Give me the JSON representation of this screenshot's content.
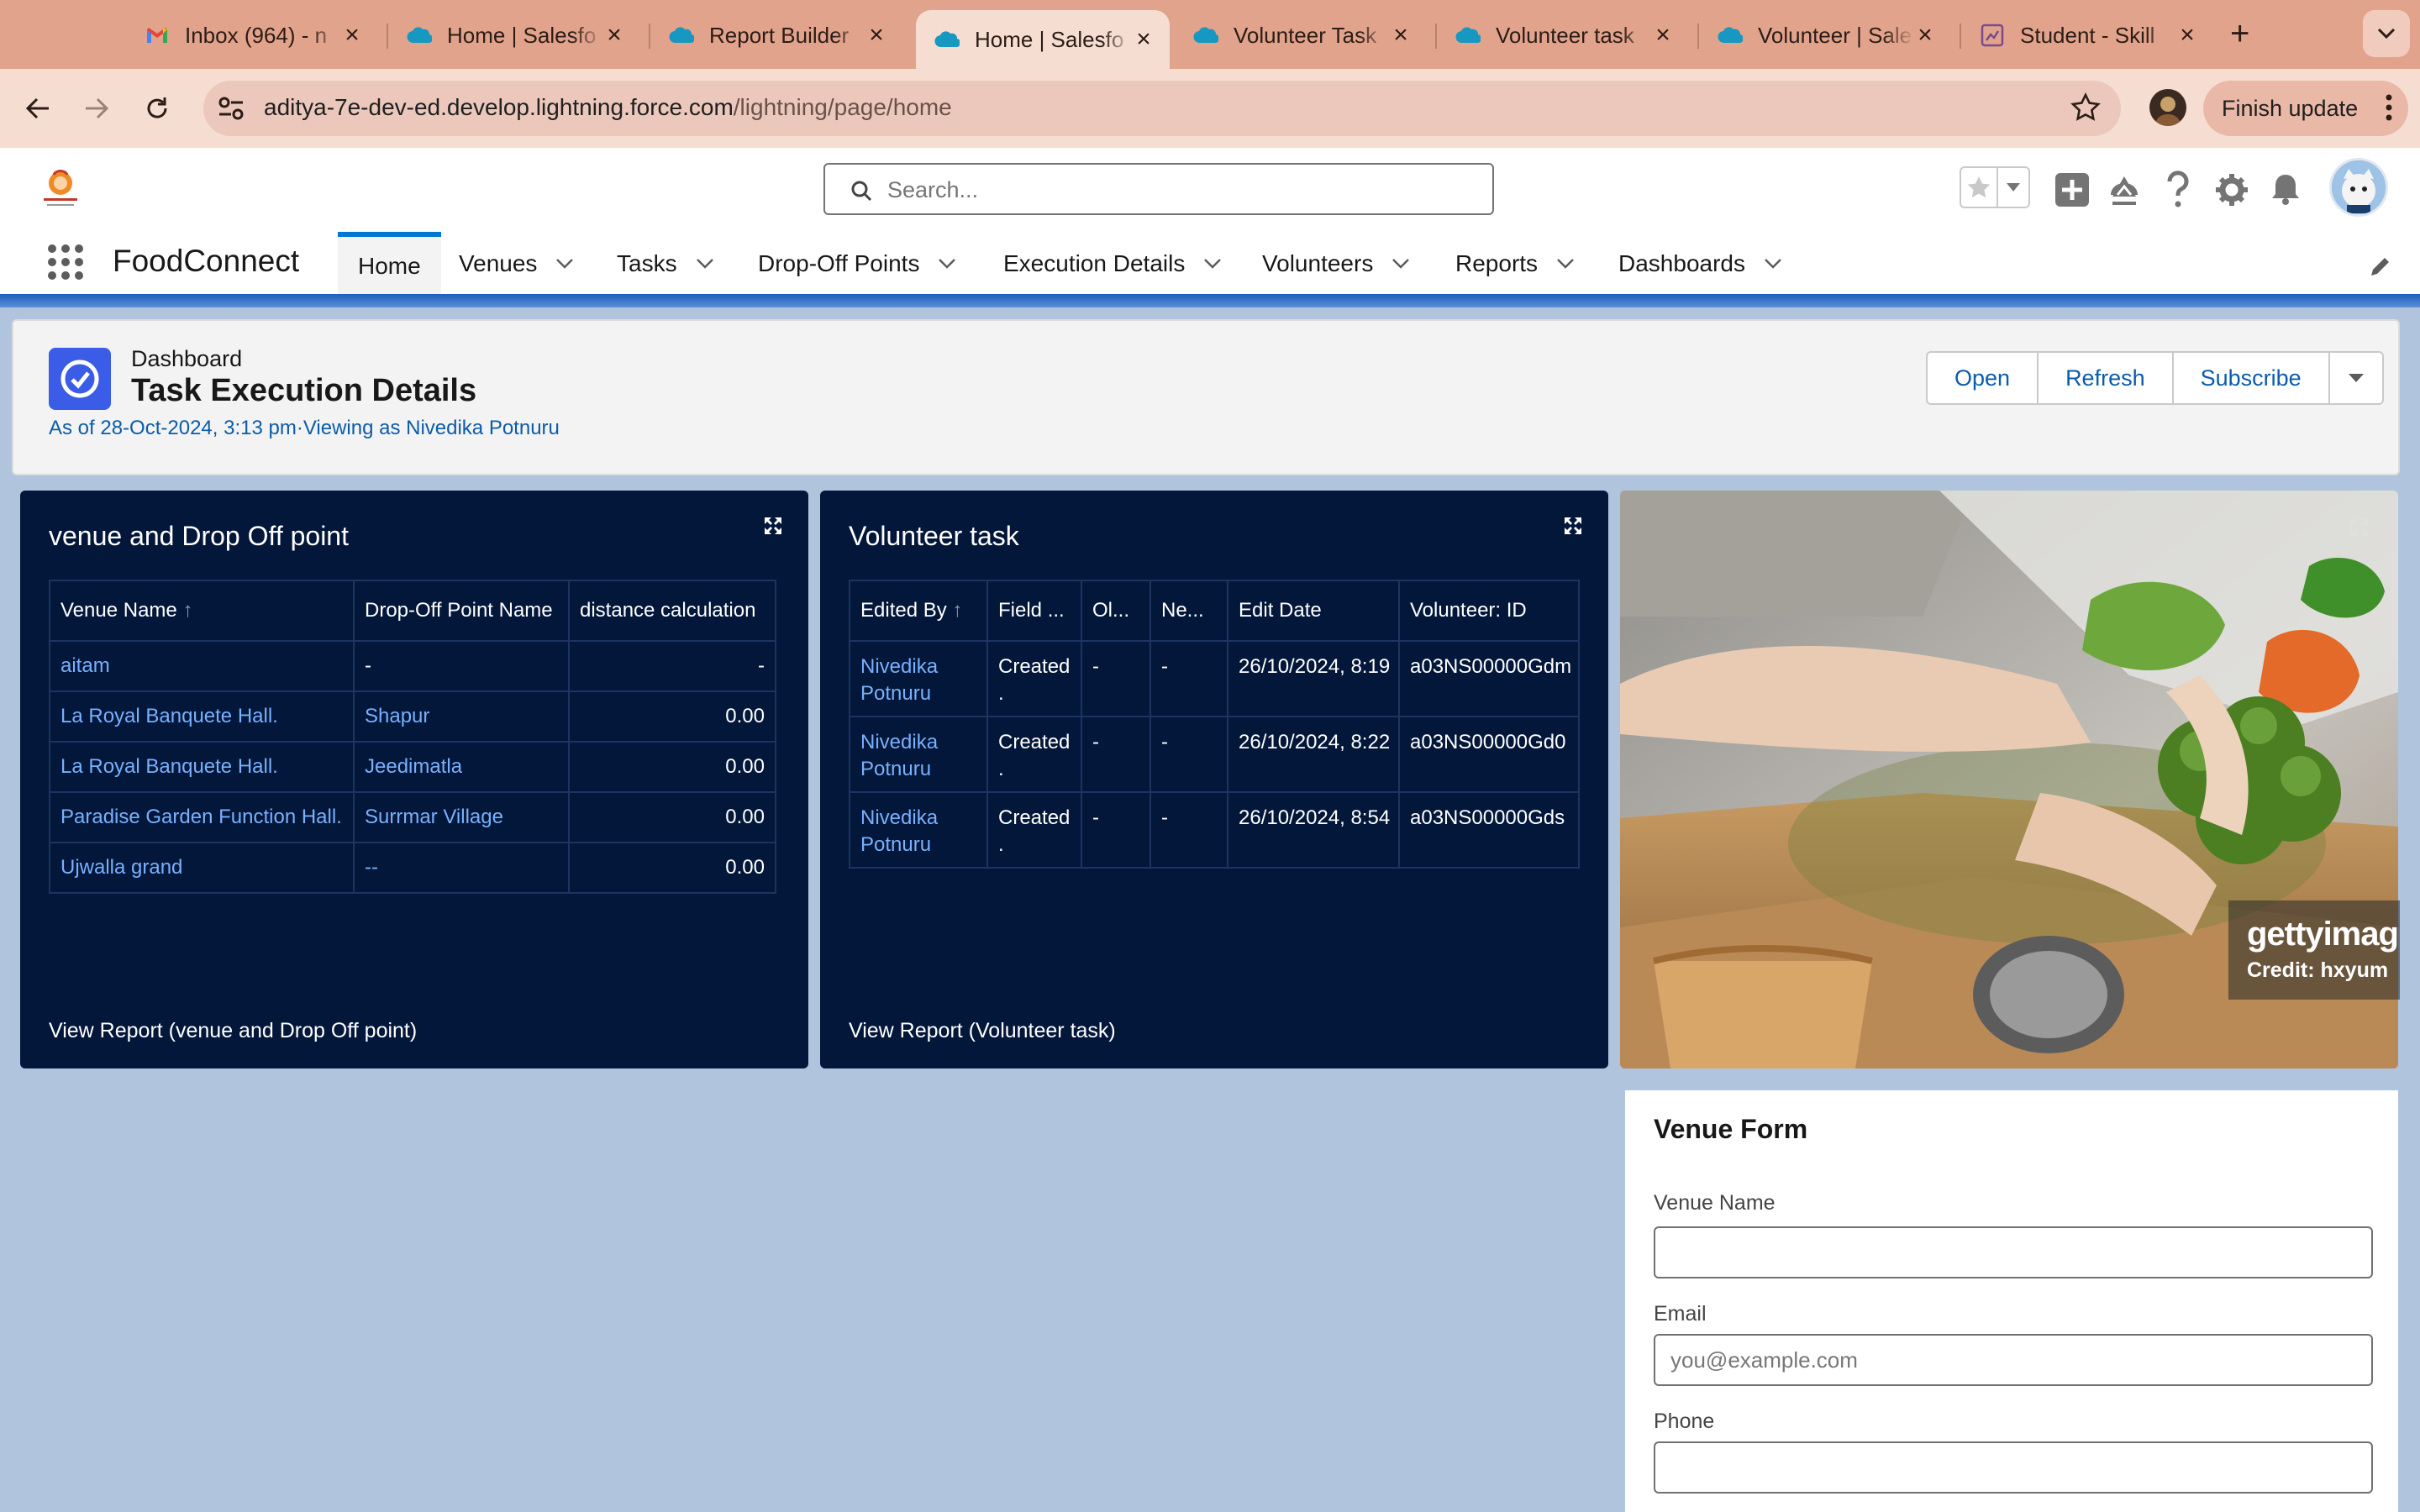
{
  "browser": {
    "tabs": [
      {
        "label": "Inbox (964) - n",
        "icon": "gmail-icon"
      },
      {
        "label": "Home | Salesfo",
        "icon": "salesforce-cloud-icon"
      },
      {
        "label": "Report Builder",
        "icon": "salesforce-cloud-icon"
      },
      {
        "label": "Home | Salesfo",
        "icon": "salesforce-cloud-icon",
        "active": true
      },
      {
        "label": "Volunteer Task",
        "icon": "salesforce-cloud-icon"
      },
      {
        "label": "Volunteer task",
        "icon": "salesforce-cloud-icon"
      },
      {
        "label": "Volunteer | Sale",
        "icon": "salesforce-cloud-icon"
      },
      {
        "label": "Student - Skill",
        "icon": "student-portal-icon"
      }
    ],
    "url_host": "aditya-7e-dev-ed.develop.lightning.force.com",
    "url_path": "/lightning/page/home",
    "finish_update": "Finish update"
  },
  "header": {
    "search_placeholder": "Search...",
    "app_name": "FoodConnect",
    "nav": [
      {
        "label": "Home",
        "active": true
      },
      {
        "label": "Venues"
      },
      {
        "label": "Tasks"
      },
      {
        "label": "Drop-Off Points"
      },
      {
        "label": "Execution Details"
      },
      {
        "label": "Volunteers"
      },
      {
        "label": "Reports"
      },
      {
        "label": "Dashboards"
      }
    ]
  },
  "dashboard": {
    "type_label": "Dashboard",
    "title": "Task Execution Details",
    "subtitle": "As of 28-Oct-2024, 3:13 pm·Viewing as Nivedika Potnuru",
    "buttons": {
      "open": "Open",
      "refresh": "Refresh",
      "subscribe": "Subscribe"
    }
  },
  "widget1": {
    "title": "venue and Drop Off point",
    "columns": [
      "Venue Name",
      "Drop-Off Point Name",
      "distance calculation"
    ],
    "sort_arrow": "↑",
    "rows": [
      {
        "venue": "aitam",
        "drop": "-",
        "dist": "-"
      },
      {
        "venue": "La Royal Banquete Hall.",
        "drop": "Shapur",
        "dist": "0.00"
      },
      {
        "venue": "La Royal Banquete Hall.",
        "drop": "Jeedimatla",
        "dist": "0.00"
      },
      {
        "venue": "Paradise Garden Function Hall.",
        "drop": "Surrmar Village",
        "dist": "0.00"
      },
      {
        "venue": "Ujwalla grand",
        "drop": "--",
        "dist": "0.00"
      }
    ],
    "footer": "View Report (venue and Drop Off point)"
  },
  "widget2": {
    "title": "Volunteer task",
    "columns": [
      "Edited By",
      "Field ...",
      "Ol...",
      "Ne...",
      "Edit Date",
      "Volunteer: ID"
    ],
    "sort_arrow": "↑",
    "rows": [
      {
        "by": "Nivedika Potnuru",
        "field": "Created .",
        "old": "-",
        "new": "-",
        "date": "26/10/2024, 8:19",
        "id": "a03NS00000Gdm"
      },
      {
        "by": "Nivedika Potnuru",
        "field": "Created .",
        "old": "-",
        "new": "-",
        "date": "26/10/2024, 8:22",
        "id": "a03NS00000Gd0"
      },
      {
        "by": "Nivedika Potnuru",
        "field": "Created .",
        "old": "-",
        "new": "-",
        "date": "26/10/2024, 8:54",
        "id": "a03NS00000Gds"
      }
    ],
    "footer": "View Report (Volunteer task)"
  },
  "image_widget": {
    "watermark": "gettyimag",
    "credit": "Credit: hxyum"
  },
  "venue_form": {
    "title": "Venue Form",
    "name_label": "Venue Name",
    "email_label": "Email",
    "email_placeholder": "you@example.com",
    "phone_label": "Phone"
  },
  "colors": {
    "accent": "#0176d3",
    "panel_bg": "#03173a",
    "link": "#78b0fd",
    "page_bg": "#b0c4de"
  }
}
